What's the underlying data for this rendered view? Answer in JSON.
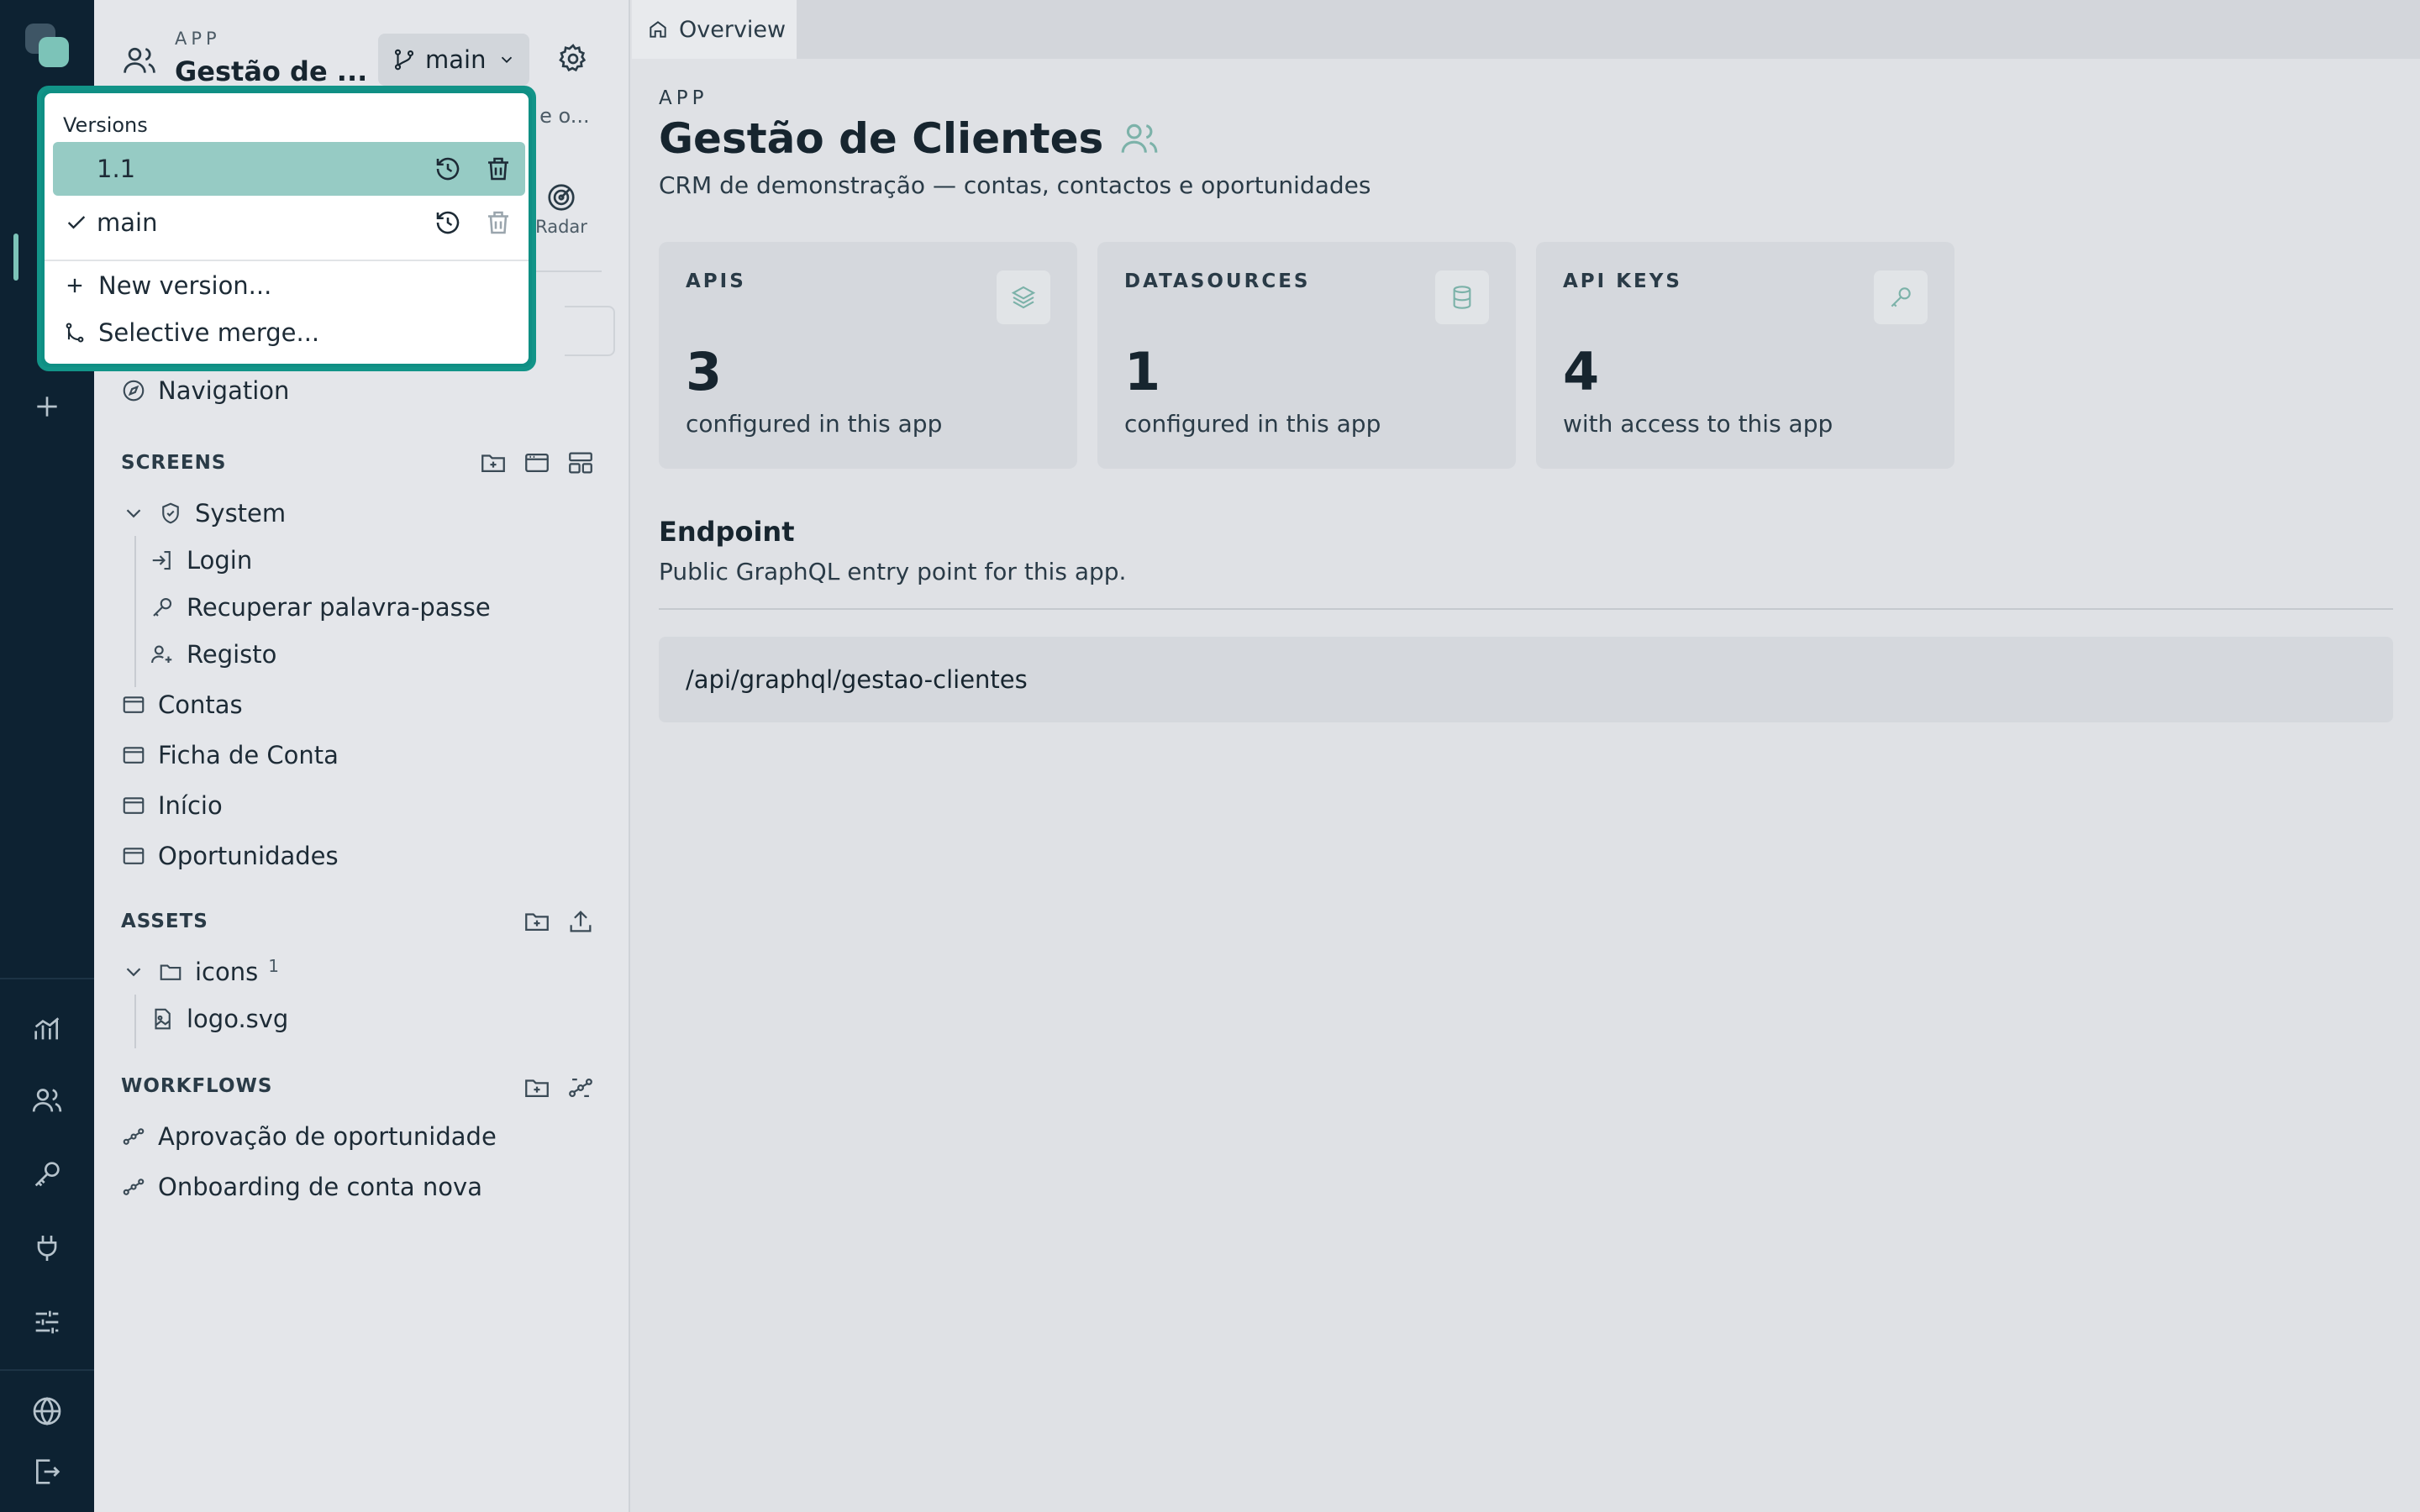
{
  "rail": {
    "icons": [
      "logo-icon",
      "add-icon",
      "analytics-icon",
      "users-icon",
      "key-icon",
      "plug-icon",
      "sliders-icon",
      "globe-icon",
      "logout-icon"
    ]
  },
  "sidebar": {
    "eyebrow": "APP",
    "app_title": "Gestão de ...",
    "branch": "main",
    "desc_truncated": "s e o...",
    "radar_label": "Radar",
    "navigation": "Navigation",
    "screens_header": "SCREENS",
    "system": "System",
    "system_children": [
      "Login",
      "Recuperar palavra-passe",
      "Registo"
    ],
    "screens": [
      "Contas",
      "Ficha de Conta",
      "Início",
      "Oportunidades"
    ],
    "assets_header": "ASSETS",
    "icons_folder": "icons",
    "icons_count": "1",
    "asset_file": "logo.svg",
    "workflows_header": "WORKFLOWS",
    "workflows": [
      "Aprovação de oportunidade",
      "Onboarding de conta nova"
    ]
  },
  "tab": {
    "label": "Overview"
  },
  "main": {
    "eyebrow": "APP",
    "title": "Gestão de Clientes",
    "subtitle": "CRM de demonstração — contas, contactos e oportunidades",
    "cards": [
      {
        "label": "APIS",
        "value": "3",
        "text": "configured in this app"
      },
      {
        "label": "DATASOURCES",
        "value": "1",
        "text": "configured in this app"
      },
      {
        "label": "API KEYS",
        "value": "4",
        "text": "with access to this app"
      }
    ],
    "endpoint_title": "Endpoint",
    "endpoint_sub": "Public GraphQL entry point for this app.",
    "endpoint_path": "/api/graphql/gestao-clientes"
  },
  "versions": {
    "header": "Versions",
    "items": [
      "1.1",
      "main"
    ],
    "new_version": "New version...",
    "selective_merge": "Selective merge..."
  },
  "colors": {
    "accent": "#129488",
    "rail": "#0d2232",
    "selected": "#96cbc4"
  }
}
